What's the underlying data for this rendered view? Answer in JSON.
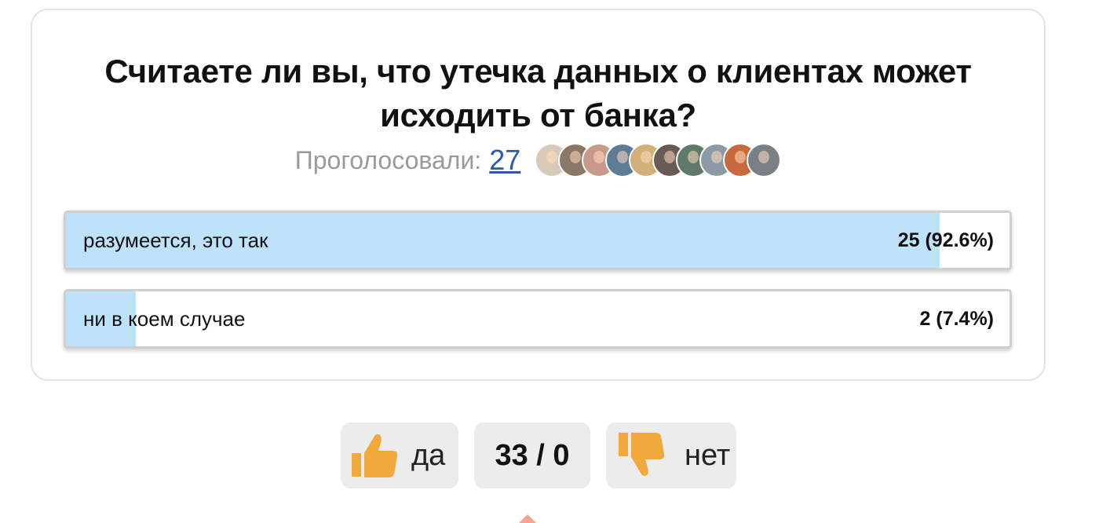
{
  "poll": {
    "question": "Считаете ли вы, что утечка данных о клиентах может исходить от банка?",
    "voters_label": "Проголосовали:",
    "voters_count": "27",
    "avatars": [
      {
        "name": "avatar-1",
        "color": "#d8c9b8"
      },
      {
        "name": "avatar-2",
        "color": "#8a7766"
      },
      {
        "name": "avatar-3",
        "color": "#c79a8c"
      },
      {
        "name": "avatar-4",
        "color": "#5d7d97"
      },
      {
        "name": "avatar-5",
        "color": "#d3b07a"
      },
      {
        "name": "avatar-6",
        "color": "#6a5a55"
      },
      {
        "name": "avatar-7",
        "color": "#5f7a6b"
      },
      {
        "name": "avatar-8",
        "color": "#8c9aa6"
      },
      {
        "name": "avatar-9",
        "color": "#c86a3d"
      },
      {
        "name": "avatar-10",
        "color": "#7a7f86"
      }
    ],
    "options": [
      {
        "label": "разумеется, это так",
        "result": "25 (92.6%)",
        "share": 0.926
      },
      {
        "label": "ни в коем случае",
        "result": "2 (7.4%)",
        "share": 0.074
      }
    ],
    "fill_color": "#bfe2fb"
  },
  "rating": {
    "yes_label": "да",
    "no_label": "нет",
    "score": "33 / 0",
    "thumb_color": "#f2a93b",
    "icons": {
      "yes": "thumbs-up-icon",
      "no": "thumbs-down-icon"
    }
  }
}
